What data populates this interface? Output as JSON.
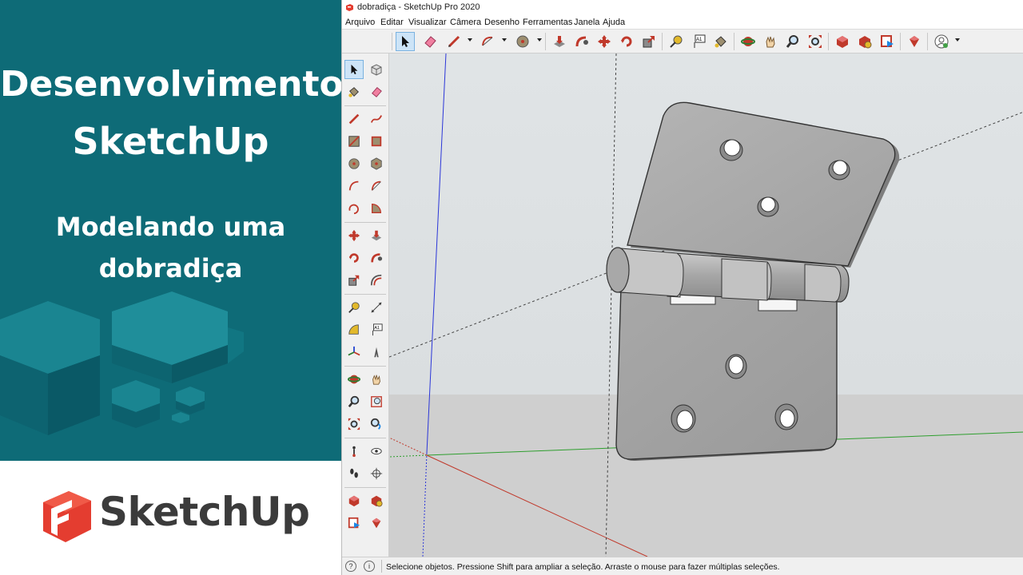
{
  "promo": {
    "title_line1": "Desenvolvimento",
    "title_line2": "SketchUp",
    "subtitle_line1": "Modelando uma",
    "subtitle_line2": "dobradiça",
    "brand_name": "SketchUp",
    "panel_color": "#0e6b77",
    "brand_red": "#e43d30"
  },
  "window": {
    "title": "dobradiça - SketchUp Pro 2020",
    "menu": [
      "Arquivo",
      "Editar",
      "Visualizar",
      "Câmera",
      "Desenho",
      "Ferramentas",
      "Janela",
      "Ajuda"
    ]
  },
  "toolbar": {
    "icons": [
      "select-icon",
      "eraser-icon",
      "pencil-icon",
      "arc-icon",
      "circle-icon",
      "push-pull-icon",
      "follow-me-icon",
      "move-icon",
      "rotate-icon",
      "scale-icon",
      "tape-measure-icon",
      "text-icon",
      "paint-bucket-icon",
      "orbit-icon",
      "pan-icon",
      "zoom-icon",
      "zoom-extents-icon",
      "3d-warehouse-icon",
      "extension-warehouse-icon",
      "layout-icon",
      "extension-manager-icon",
      "user-icon"
    ]
  },
  "left_toolbar": {
    "icons": [
      "select-icon",
      "make-component-icon",
      "paint-bucket-icon",
      "eraser-icon",
      "pencil-icon",
      "freehand-icon",
      "rectangle-icon",
      "rotated-rectangle-icon",
      "circle-icon",
      "polygon-icon",
      "arc-icon",
      "two-point-arc-icon",
      "three-point-arc-icon",
      "pie-icon",
      "move-icon",
      "push-pull-icon",
      "rotate-icon",
      "follow-me-icon",
      "scale-icon",
      "offset-icon",
      "tape-measure-icon",
      "dimension-icon",
      "protractor-icon",
      "text-icon",
      "axes-icon",
      "3d-text-icon",
      "orbit-icon",
      "pan-icon",
      "zoom-icon",
      "zoom-window-icon",
      "zoom-extents-icon",
      "previous-view-icon",
      "position-camera-icon",
      "look-around-icon",
      "walk-icon",
      "section-plane-icon",
      "3d-warehouse-icon",
      "extension-warehouse-icon",
      "layout-icon",
      "extension-manager-icon"
    ]
  },
  "viewport": {
    "sky_color": "#dfe3e6",
    "ground_color": "#cfcfcf",
    "model": "hinge"
  },
  "status": {
    "text": "Selecione objetos. Pressione Shift para ampliar a seleção. Arraste o mouse para fazer múltiplas seleções.",
    "icon1": "?",
    "icon2": "i"
  }
}
